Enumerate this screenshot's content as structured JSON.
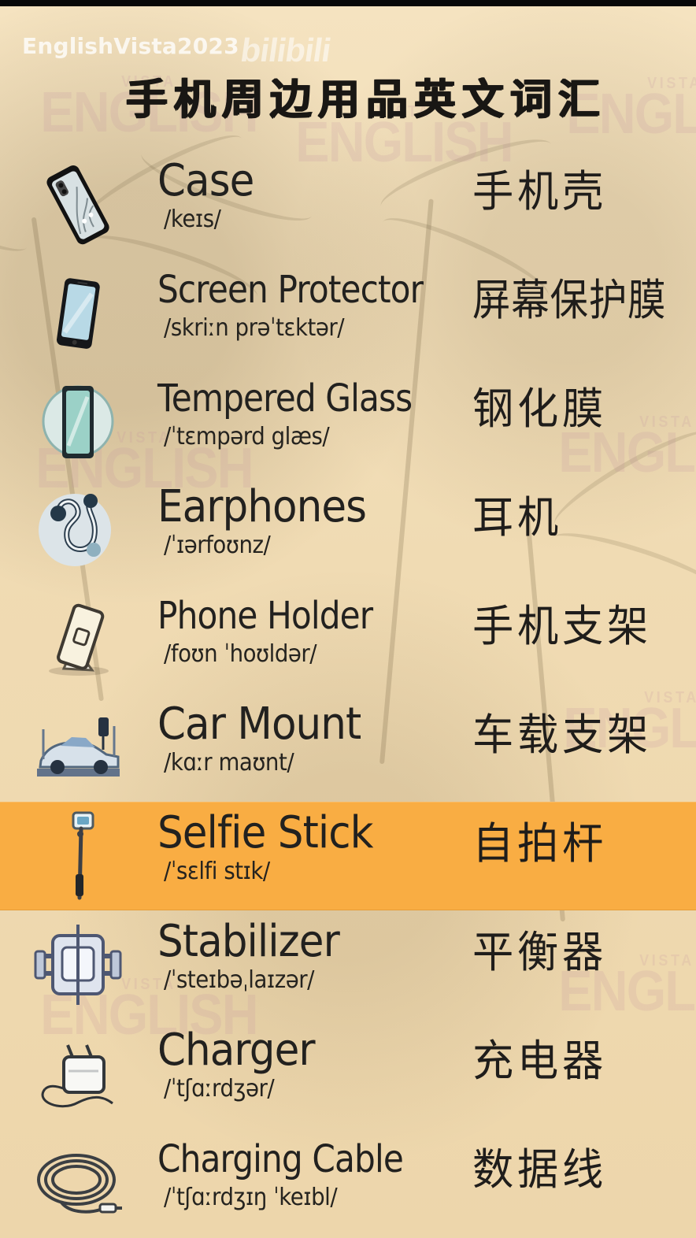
{
  "header": {
    "source_label": "EnglishVista2023",
    "site_logo": "bilibili",
    "title": "手机周边用品英文词汇"
  },
  "watermarks": [
    {
      "small": "VISTA",
      "big": "ENGLISH"
    },
    {
      "small": "VISTA",
      "big": "ENGLISH"
    },
    {
      "small": "VISTA",
      "big": "ENGLISH"
    },
    {
      "small": "VISTA",
      "big": "ENGLISH"
    },
    {
      "small": "VISTA",
      "big": "ENGLISH"
    },
    {
      "small": "VISTA",
      "big": "ENGLISH"
    },
    {
      "small": "VISTA",
      "big": "ENGLISH"
    },
    {
      "small": "VISTA",
      "big": "ENGLISH"
    }
  ],
  "vocabulary": [
    {
      "icon": "phone-case-icon",
      "english": "Case",
      "phonetic": "/keɪs/",
      "chinese": "手机壳"
    },
    {
      "icon": "smartphone-icon",
      "english": "Screen Protector",
      "phonetic": "/skriːn prəˈtɛktər/",
      "chinese": "屏幕保护膜"
    },
    {
      "icon": "tempered-glass-icon",
      "english": "Tempered Glass",
      "phonetic": "/ˈtɛmpərd glæs/",
      "chinese": "钢化膜"
    },
    {
      "icon": "earphones-icon",
      "english": "Earphones",
      "phonetic": "/ˈɪərfoʊnz/",
      "chinese": "耳机"
    },
    {
      "icon": "phone-holder-icon",
      "english": "Phone Holder",
      "phonetic": "/foʊn ˈhoʊldər/",
      "chinese": "手机支架"
    },
    {
      "icon": "car-mount-icon",
      "english": "Car Mount",
      "phonetic": "/kɑːr maʊnt/",
      "chinese": "车载支架"
    },
    {
      "icon": "selfie-stick-icon",
      "english": "Selfie Stick",
      "phonetic": "/ˈsɛlfi stɪk/",
      "chinese": "自拍杆"
    },
    {
      "icon": "stabilizer-icon",
      "english": "Stabilizer",
      "phonetic": "/ˈsteɪbəˌlaɪzər/",
      "chinese": "平衡器"
    },
    {
      "icon": "charger-icon",
      "english": "Charger",
      "phonetic": "/ˈtʃɑːrdʒər/",
      "chinese": "充电器"
    },
    {
      "icon": "charging-cable-icon",
      "english": "Charging Cable",
      "phonetic": "/ˈtʃɑːrdʒɪŋ ˈkeɪbl/",
      "chinese": "数据线"
    }
  ],
  "highlighted_row": "Selfie Stick",
  "colors": {
    "background": "#f0dbb3",
    "highlight": "#f9ad43",
    "text": "#22211f"
  }
}
